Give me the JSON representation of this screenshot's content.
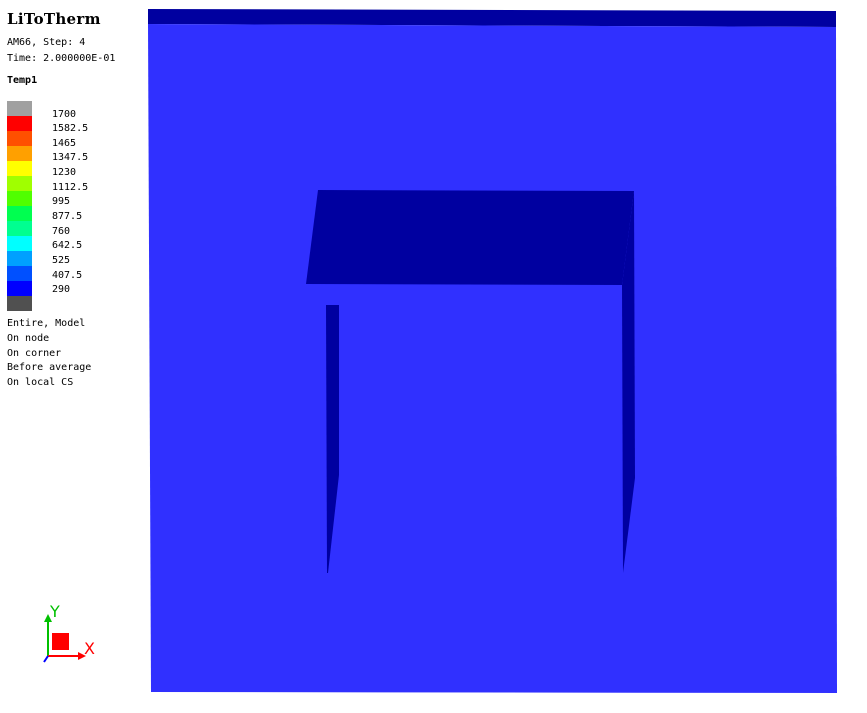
{
  "app": {
    "title": "LiToTherm"
  },
  "info": {
    "model_step": "AM66, Step: 4",
    "time": "Time: 2.000000E-01"
  },
  "variable": {
    "name": "Temp1"
  },
  "legend": {
    "entries": [
      {
        "label": "1700",
        "color": "#a0a0a0"
      },
      {
        "label": "1582.5",
        "color": "#ff0000"
      },
      {
        "label": "1465",
        "color": "#ff5000"
      },
      {
        "label": "1347.5",
        "color": "#ffa000"
      },
      {
        "label": "1230",
        "color": "#ffff00"
      },
      {
        "label": "1112.5",
        "color": "#a0ff00"
      },
      {
        "label": "995",
        "color": "#50ff00"
      },
      {
        "label": "877.5",
        "color": "#00ff50"
      },
      {
        "label": "760",
        "color": "#00ff90"
      },
      {
        "label": "642.5",
        "color": "#00ffff"
      },
      {
        "label": "525",
        "color": "#00a0ff"
      },
      {
        "label": "407.5",
        "color": "#0050ff"
      },
      {
        "label": "290",
        "color": "#0000ff"
      },
      {
        "label": "",
        "color": "#505050"
      }
    ]
  },
  "options": {
    "lines": [
      "Entire, Model",
      "On node",
      "On corner",
      "Before average",
      "On local CS"
    ]
  },
  "axes": {
    "x_label": "X",
    "y_label": "Y",
    "x_color": "#ff0000",
    "y_color": "#00c000",
    "z_color": "#0000ff"
  },
  "colors": {
    "model_face": "#3030ff",
    "model_edge": "#0000a0"
  }
}
